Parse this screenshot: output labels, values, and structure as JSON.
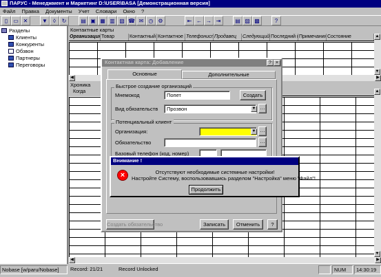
{
  "app": {
    "title": "ПАРУС - Менеджмент и Маркетинг  D:\\USER\\BASA [Демонстрационная версия]"
  },
  "menu": [
    "Файл",
    "Правка",
    "Документы",
    "Учет",
    "Словари",
    "Окно",
    "?"
  ],
  "tree": {
    "root": "Разделы",
    "items": [
      "Клиенты",
      "Конкуренты",
      "Обзвон",
      "Партнеры",
      "Переговоры"
    ]
  },
  "contacts_panel": {
    "title": "Контактные карты",
    "columns": [
      "Организация",
      "Товар",
      "Контактный т",
      "Контактное л",
      "Телефонист",
      "Продавец",
      "Следующий",
      "Последний к",
      "Примечания",
      "Состояние"
    ]
  },
  "chronicle_panel": {
    "title": "Хроника",
    "columns": [
      "Когда"
    ]
  },
  "dialog": {
    "title": "Контактная карта: Добавление",
    "help_glyph": "?",
    "close_glyph": "×",
    "tabs": [
      "Основные",
      "Дополнительные"
    ],
    "quick_group": "Быстрое создание организаций",
    "mnemocode_label": "Мнемокод",
    "mnemocode_value": "Попет",
    "create_button": "Создать",
    "obligation_type_label": "Вид обязательств",
    "obligation_type_value": "Прозвон",
    "potential_group": "Потенциальный клиент",
    "org_label": "Организация:",
    "obligation_label": "Обязательство",
    "phone_label": "Базовый телефон (код, номер)",
    "create_obligation_button": "Создать обязательство",
    "save_button": "Записать",
    "cancel_button": "Отменить",
    "help_button": "?"
  },
  "alert": {
    "title": "Внимание !",
    "line1": "Отсутствуют необходимые системные настройки!",
    "line2": "Настройте Систему, воспользовавшись разделом \"Настройка\" меню \"Файл\"!",
    "continue_button": "Продолжить",
    "icon_glyph": "×"
  },
  "statusbar": {
    "database": "Nobase [w/paru/Nobase]",
    "record": "Record: 21/21",
    "lock": "Record Unlocked",
    "num": "NUM",
    "time": "14:30:19"
  },
  "colors": {
    "window_bg": "#c0c0c0",
    "titlebar_active": "#000080",
    "org_field": "#ffff00",
    "error_icon": "#ff0000"
  }
}
